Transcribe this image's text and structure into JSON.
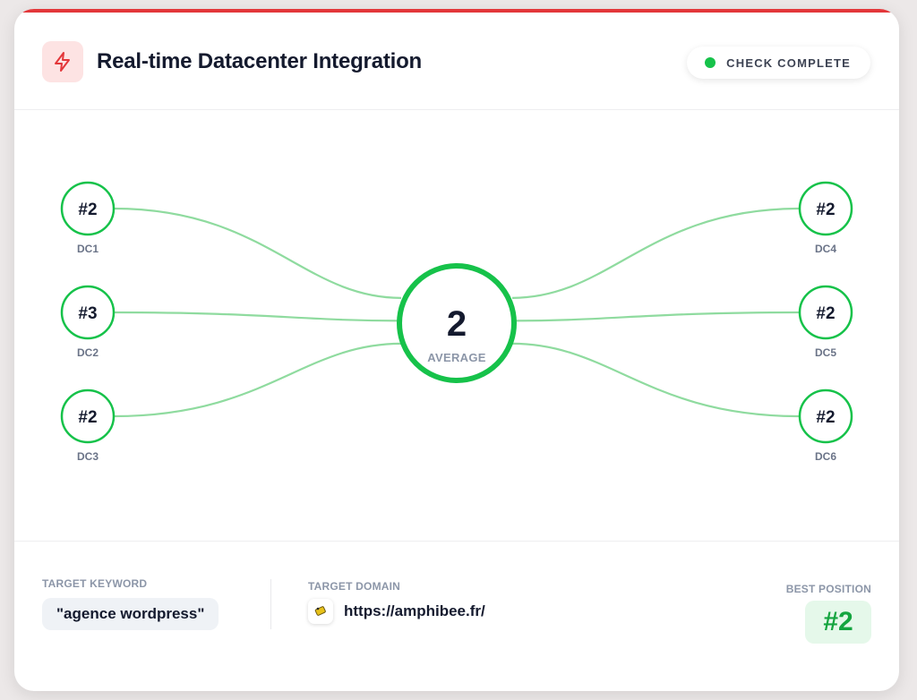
{
  "header": {
    "title": "Real-time Datacenter Integration",
    "status": "CHECK COMPLETE",
    "icon": "lightning-bolt-icon"
  },
  "network": {
    "center": {
      "value": "2",
      "label": "AVERAGE"
    },
    "nodes": [
      {
        "id": "DC1",
        "rank": "#2",
        "side": "left"
      },
      {
        "id": "DC2",
        "rank": "#3",
        "side": "left"
      },
      {
        "id": "DC3",
        "rank": "#2",
        "side": "left"
      },
      {
        "id": "DC4",
        "rank": "#2",
        "side": "right"
      },
      {
        "id": "DC5",
        "rank": "#2",
        "side": "right"
      },
      {
        "id": "DC6",
        "rank": "#2",
        "side": "right"
      }
    ]
  },
  "footer": {
    "keyword_label": "TARGET KEYWORD",
    "keyword": "\"agence wordpress\"",
    "domain_label": "TARGET DOMAIN",
    "domain": "https://amphibee.fr/",
    "best_label": "BEST POSITION",
    "best_value": "#2"
  },
  "colors": {
    "accent_red": "#e3373a",
    "success_green": "#16c24a",
    "link_green": "#8fdb9f",
    "text_dark": "#141a2e",
    "label_gray": "#8c96a8"
  }
}
